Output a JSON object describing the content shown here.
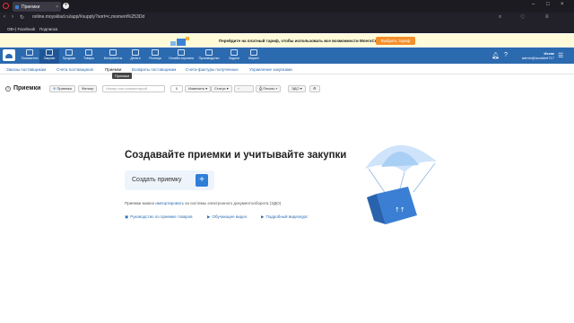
{
  "browser": {
    "tab_title": "Приемки",
    "url": "online.moysklad.ru/app/#supply?sort=c,moment%253Dd",
    "bookmarks": [
      "OB+| Facebook",
      "Подписка"
    ]
  },
  "banner": {
    "text": "Перейдите на платный тариф, чтобы использовать все возможности МоегоСклада",
    "button": "Выбрать тариф"
  },
  "nav": {
    "items": [
      "Показатели",
      "Закупки",
      "Продажи",
      "Товары",
      "Контрагенты",
      "Деньги",
      "Розница",
      "Онлайн-торговля",
      "Производство",
      "Задачи",
      "Маркет",
      "Роуминг"
    ],
    "active_index": 1
  },
  "user": {
    "name": "Исхак",
    "email": "admin@isxokbel717"
  },
  "subnav": {
    "items": [
      "Заказы поставщикам",
      "Счета поставщиков",
      "Приемки",
      "Возвраты поставщикам",
      "Счета-фактуры полученные",
      "Управление закупками"
    ],
    "tooltip": "Приемки"
  },
  "toolbar": {
    "title": "Приемки",
    "add_button": "Приемка",
    "filter_button": "Фильтр",
    "search_placeholder": "Номер или комментарий",
    "count": "0",
    "change_menu": "Изменить",
    "status_menu": "Статус",
    "print_menu": "Печать",
    "edo_menu": "ЭДО"
  },
  "main": {
    "heading": "Создавайте приемки и учитывайте закупки",
    "create_label": "Создать приемку",
    "create_plus": "+",
    "note_prefix": "Приемки можно ",
    "note_link": "импортировать",
    "note_suffix": " из системы электронного документооборота (ЭДО)",
    "links": [
      "Руководство по приемке товаров",
      "Обучающее видео",
      "Подробный видеокурс"
    ]
  }
}
